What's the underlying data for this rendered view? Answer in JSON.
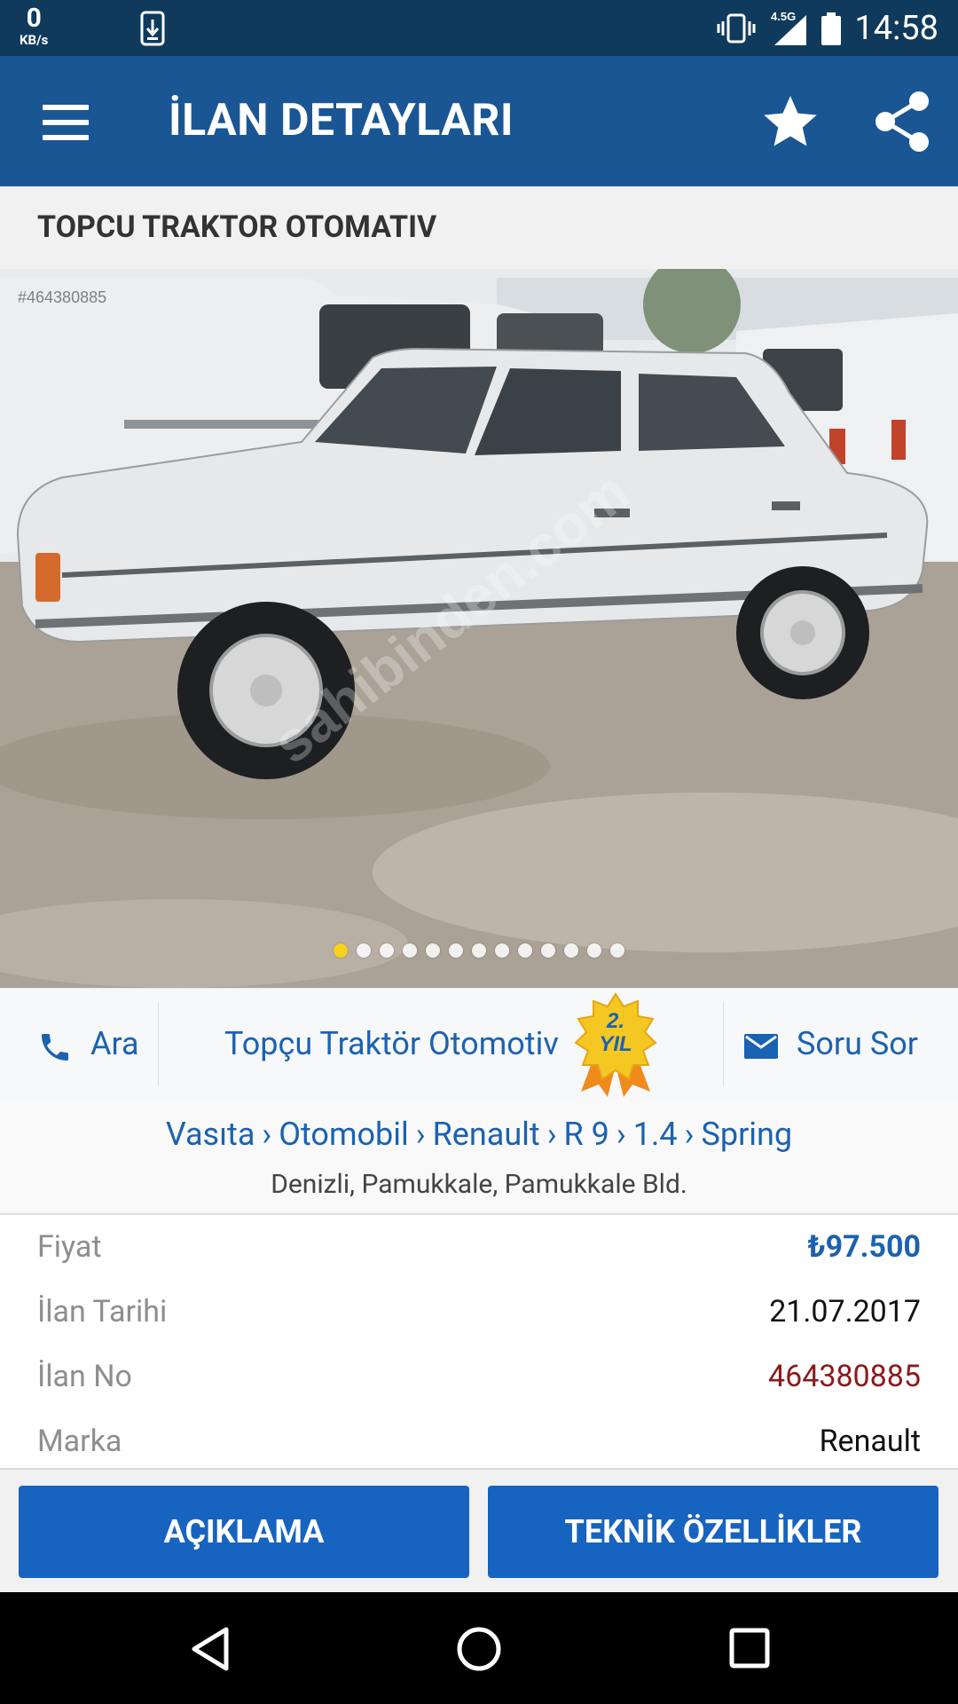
{
  "status_bar": {
    "net_speed": "0",
    "net_speed_unit": "KB/s",
    "network": "4.5G",
    "time": "14:58"
  },
  "app_bar": {
    "title": "İLAN DETAYLARI"
  },
  "seller": {
    "header_name": "TOPCU TRAKTOR OTOMATIV"
  },
  "gallery": {
    "watermark_id": "#464380885",
    "watermark_text": "sahibinden.com",
    "dot_count": 13,
    "active_index": 0
  },
  "actions": {
    "call_label": "Ara",
    "store_label": "Topçu Traktör Otomotiv",
    "badge_line1": "2.",
    "badge_line2": "YIL",
    "message_label": "Soru Sor"
  },
  "breadcrumb": [
    "Vasıta",
    "Otomobil",
    "Renault",
    "R 9",
    "1.4",
    "Spring"
  ],
  "location": "Denizli, Pamukkale, Pamukkale Bld.",
  "details": [
    {
      "label": "Fiyat",
      "value": "₺97.500"
    },
    {
      "label": "İlan Tarihi",
      "value": "21.07.2017"
    },
    {
      "label": "İlan No",
      "value": "464380885"
    },
    {
      "label": "Marka",
      "value": "Renault"
    }
  ],
  "buttons": {
    "description": "AÇIKLAMA",
    "tech_specs": "TEKNİK ÖZELLİKLER"
  },
  "colors": {
    "app_bar": "#1a5693",
    "status_bar": "#0f3a5c",
    "accent_blue": "#1b62b0",
    "button_blue": "#1763c0",
    "listing_no_red": "#8b1a1a",
    "active_dot": "#f6d21d"
  }
}
